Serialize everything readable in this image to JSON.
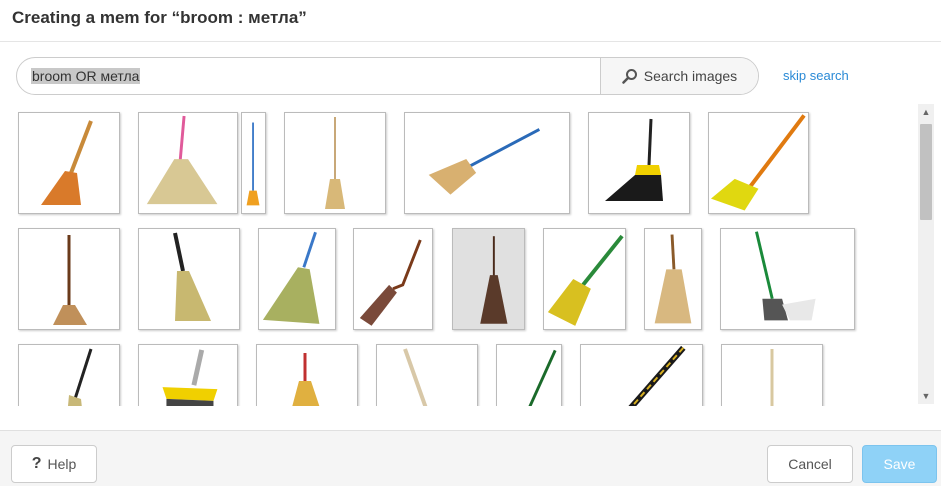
{
  "dialog": {
    "title": "Creating a mem for “broom : метла”"
  },
  "search": {
    "query": "broom OR метла",
    "button_label": "Search images",
    "skip_label": "skip search"
  },
  "footer": {
    "help_label": "Help",
    "cancel_label": "Cancel",
    "save_label": "Save"
  },
  "icons": {
    "search": "magnifier-icon",
    "help": "question-icon",
    "scroll_up": "triangle-up-icon",
    "scroll_down": "triangle-down-icon"
  },
  "colors": {
    "link": "#2a8ad6",
    "save_button": "#8fd2f7"
  }
}
